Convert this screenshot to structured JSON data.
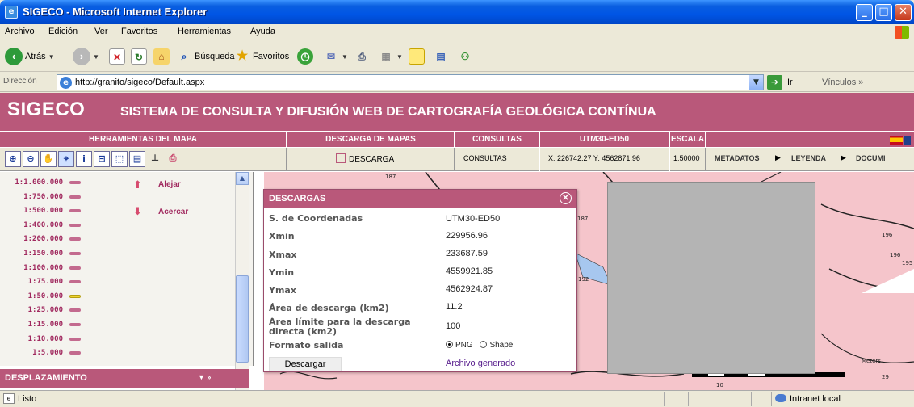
{
  "window": {
    "title": "SIGECO - Microsoft Internet Explorer",
    "min": "_",
    "max": "□",
    "close": "✕"
  },
  "menu": [
    "Archivo",
    "Edición",
    "Ver",
    "Favoritos",
    "Herramientas",
    "Ayuda"
  ],
  "toolbar": {
    "back": "Atrás",
    "search": "Búsqueda",
    "favorites": "Favoritos"
  },
  "address": {
    "label": "Dirección",
    "url": "http://granito/sigeco/Default.aspx",
    "go": "Ir",
    "links": "Vínculos"
  },
  "banner": {
    "big": "SIGECO",
    "sub": "SISTEMA DE CONSULTA Y DIFUSIÓN WEB DE CARTOGRAFÍA GEOLÓGICA CONTÍNUA"
  },
  "headers": {
    "tools": "HERRAMIENTAS DEL MAPA",
    "downloads": "DESCARGA DE MAPAS",
    "queries": "CONSULTAS",
    "coords": "UTM30-ED50",
    "scale": "ESCALA"
  },
  "controls": {
    "download": "DESCARGA",
    "queries": "CONSULTAS",
    "coords": "X: 226742.27 Y: 4562871.96",
    "scale": "1:50000",
    "nav": [
      "METADATOS",
      "LEYENDA",
      "DOCUMI"
    ]
  },
  "scales": [
    {
      "label": "1:1.000.000",
      "selected": false
    },
    {
      "label": "1:750.000",
      "selected": false
    },
    {
      "label": "1:500.000",
      "selected": false
    },
    {
      "label": "1:400.000",
      "selected": false
    },
    {
      "label": "1:200.000",
      "selected": false
    },
    {
      "label": "1:150.000",
      "selected": false
    },
    {
      "label": "1:100.000",
      "selected": false
    },
    {
      "label": "1:75.000",
      "selected": false
    },
    {
      "label": "1:50.000",
      "selected": true
    },
    {
      "label": "1:25.000",
      "selected": false
    },
    {
      "label": "1:15.000",
      "selected": false
    },
    {
      "label": "1:10.000",
      "selected": false
    },
    {
      "label": "1:5.000",
      "selected": false
    }
  ],
  "zoom": {
    "out": "Alejar",
    "in": "Acercar"
  },
  "pan_panel": {
    "title": "DESPLAZAMIENTO"
  },
  "dialog": {
    "title": "DESCARGAS",
    "rows": [
      {
        "label": "S. de Coordenadas",
        "value": "UTM30-ED50"
      },
      {
        "label": "Xmin",
        "value": "229956.96"
      },
      {
        "label": "Xmax",
        "value": "233687.59"
      },
      {
        "label": "Ymin",
        "value": "4559921.85"
      },
      {
        "label": "Ymax",
        "value": "4562924.87"
      },
      {
        "label": "Área de descarga (km2)",
        "value": "11.2"
      },
      {
        "label": "Área límite para la descarga directa (km2)",
        "value": "100"
      }
    ],
    "format_label": "Formato salida",
    "format_options": [
      "PNG",
      "Shape"
    ],
    "format_selected": "PNG",
    "button": "Descargar",
    "link": "Archivo generado"
  },
  "map_labels": [
    "187",
    "187",
    "192",
    "196",
    "195",
    "196",
    "Meters",
    "29",
    "10"
  ],
  "status": {
    "text": "Listo",
    "zone": "Intranet local"
  }
}
